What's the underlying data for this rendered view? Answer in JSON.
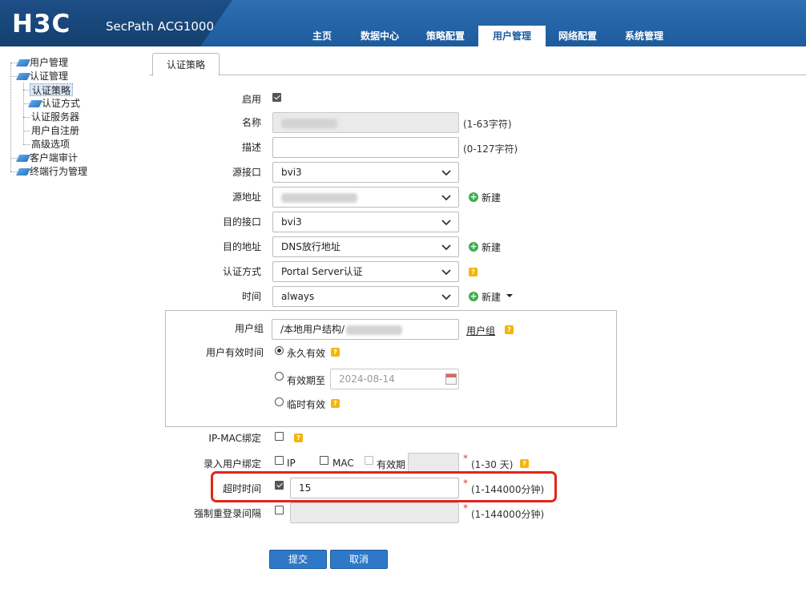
{
  "header": {
    "logo": "H3C",
    "product": "SecPath ACG1000",
    "nav": [
      {
        "label": "主页"
      },
      {
        "label": "数据中心"
      },
      {
        "label": "策略配置"
      },
      {
        "label": "用户管理",
        "active": true
      },
      {
        "label": "网络配置"
      },
      {
        "label": "系统管理"
      }
    ]
  },
  "sidebar": {
    "items": [
      {
        "label": "用户管理"
      },
      {
        "label": "认证管理"
      },
      {
        "label": "认证策略",
        "selected": true
      },
      {
        "label": "认证方式"
      },
      {
        "label": "认证服务器"
      },
      {
        "label": "用户自注册"
      },
      {
        "label": "高级选项"
      },
      {
        "label": "客户端审计"
      },
      {
        "label": "终端行为管理"
      }
    ]
  },
  "tab": {
    "label": "认证策略"
  },
  "form": {
    "enable": {
      "label": "启用",
      "checked": true
    },
    "name": {
      "label": "名称",
      "hint": "(1-63字符)"
    },
    "desc": {
      "label": "描述",
      "value": "",
      "hint": "(0-127字符)"
    },
    "src_if": {
      "label": "源接口",
      "value": "bvi3"
    },
    "src_addr": {
      "label": "源地址",
      "add_label": "新建"
    },
    "dst_if": {
      "label": "目的接口",
      "value": "bvi3"
    },
    "dst_addr": {
      "label": "目的地址",
      "value": "DNS放行地址",
      "add_label": "新建"
    },
    "auth_method": {
      "label": "认证方式",
      "value": "Portal Server认证"
    },
    "time": {
      "label": "时间",
      "value": "always",
      "add_label": "新建"
    },
    "user_group": {
      "label": "用户组",
      "value": "/本地用户结构/",
      "link": "用户组"
    },
    "validity": {
      "label": "用户有效时间",
      "permanent": "永久有效",
      "until": "有效期至",
      "until_date": "2024-08-14",
      "temporary": "临时有效"
    },
    "ipmac": {
      "label": "IP-MAC绑定"
    },
    "entry_bind": {
      "label": "录入用户绑定",
      "ip": "IP",
      "mac": "MAC",
      "validity": "有效期",
      "req": "*",
      "hint": "(1-30 天)"
    },
    "timeout": {
      "label": "超时时间",
      "checked": true,
      "value": "15",
      "req": "*",
      "hint": "(1-144000分钟)"
    },
    "relogin": {
      "label": "强制重登录间隔",
      "req": "*",
      "hint": "(1-144000分钟)"
    },
    "submit": "提交",
    "cancel": "取消"
  },
  "colors": {
    "header_dark": "#14406f",
    "header_light": "#2e6fb2",
    "button": "#2e78c7",
    "highlight": "#e1251b",
    "help": "#f2b50f",
    "add": "#3cae4b"
  }
}
